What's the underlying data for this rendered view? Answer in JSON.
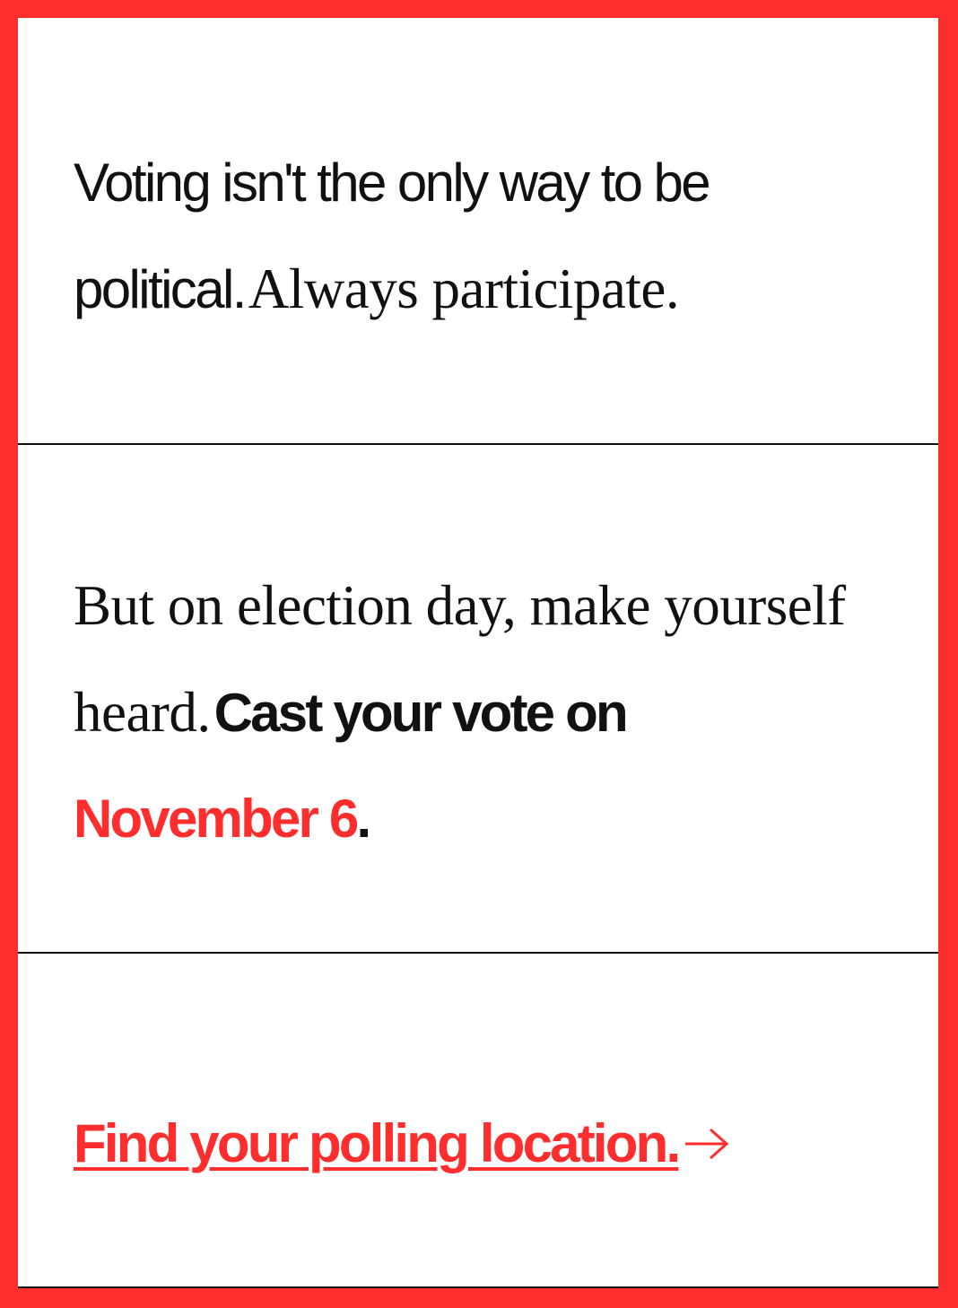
{
  "colors": {
    "accent": "#ff2e2e",
    "text": "#111111",
    "background": "#ffffff"
  },
  "section1": {
    "sans_text": "Voting isn't the only way to be political.",
    "serif_text": "Always participate."
  },
  "section2": {
    "serif_text": "But on election day, make yourself heard.",
    "bold_text": "Cast your vote on",
    "date_text": "November 6",
    "period": "."
  },
  "section3": {
    "link_label": "Find your polling location.",
    "link_icon": "arrow-right-icon"
  }
}
